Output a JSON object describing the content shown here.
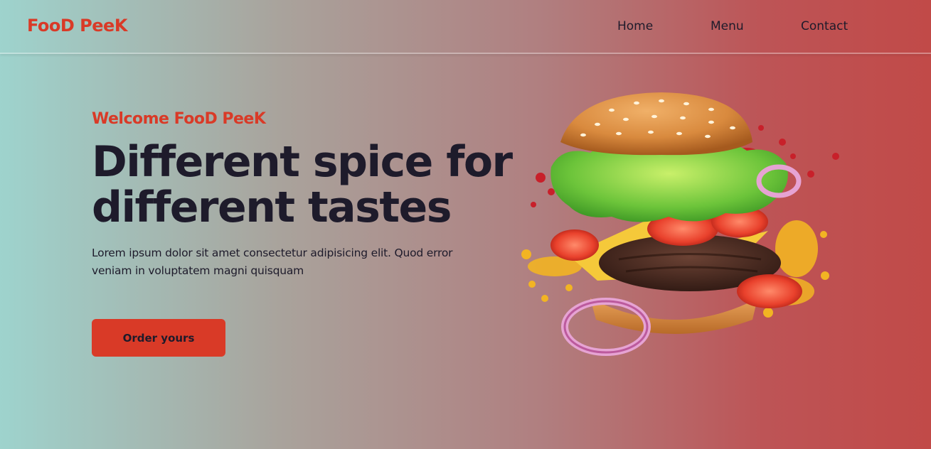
{
  "brand": {
    "name": "FooD PeeK",
    "accent": "#d93a27"
  },
  "nav": {
    "home": "Home",
    "menu": "Menu",
    "contact": "Contact"
  },
  "hero": {
    "welcome": "Welcome FooD PeeK",
    "headline_line1": "Different spice for",
    "headline_line2": "different tastes",
    "blurb": "Lorem ipsum dolor sit amet consectetur adipisicing elit. Quod error veniam in voluptatem magni quisquam",
    "cta_label": "Order yours"
  },
  "image": {
    "subject": "burger-image"
  }
}
